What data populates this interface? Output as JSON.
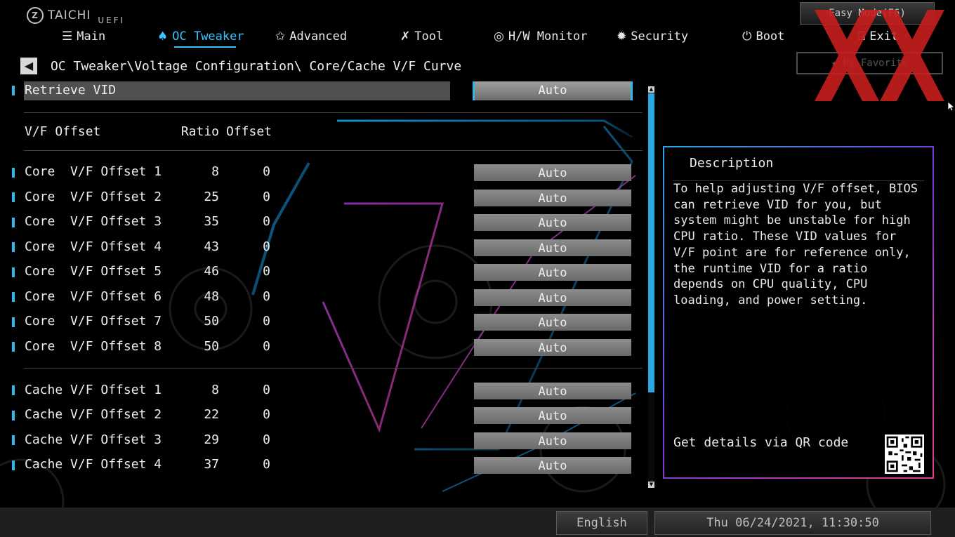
{
  "brand": {
    "name": "TAICHI",
    "suffix": "UEFI",
    "badge": "Z"
  },
  "colors": {
    "accent": "#37c5ff",
    "marker": "#2fb8f0",
    "watermark": "#c81e1e",
    "background": "#000000"
  },
  "nav": [
    {
      "label": "Main",
      "icon": "list-icon"
    },
    {
      "label": "OC Tweaker",
      "icon": "rocket-icon",
      "active": true
    },
    {
      "label": "Advanced",
      "icon": "star-icon"
    },
    {
      "label": "Tool",
      "icon": "tools-icon"
    },
    {
      "label": "H/W Monitor",
      "icon": "monitor-gauge-icon"
    },
    {
      "label": "Security",
      "icon": "shield-gear-icon"
    },
    {
      "label": "Boot",
      "icon": "power-icon"
    },
    {
      "label": "Exit",
      "icon": "exit-door-icon"
    }
  ],
  "top_buttons": {
    "easy_mode": "Easy Mode(F6)",
    "favorite": "My Favorite"
  },
  "breadcrumb": "OC Tweaker\\Voltage Configuration\\ Core/Cache V/F Curve",
  "retrieve": {
    "label": "Retrieve VID",
    "value": "Auto"
  },
  "table_header": {
    "col1": "V/F Offset",
    "col2": "Ratio",
    "col3": "Offset"
  },
  "core_rows": [
    {
      "label": "Core  V/F Offset 1",
      "ratio": "8",
      "offset": "0",
      "value": "Auto"
    },
    {
      "label": "Core  V/F Offset 2",
      "ratio": "25",
      "offset": "0",
      "value": "Auto"
    },
    {
      "label": "Core  V/F Offset 3",
      "ratio": "35",
      "offset": "0",
      "value": "Auto"
    },
    {
      "label": "Core  V/F Offset 4",
      "ratio": "43",
      "offset": "0",
      "value": "Auto"
    },
    {
      "label": "Core  V/F Offset 5",
      "ratio": "46",
      "offset": "0",
      "value": "Auto"
    },
    {
      "label": "Core  V/F Offset 6",
      "ratio": "48",
      "offset": "0",
      "value": "Auto"
    },
    {
      "label": "Core  V/F Offset 7",
      "ratio": "50",
      "offset": "0",
      "value": "Auto"
    },
    {
      "label": "Core  V/F Offset 8",
      "ratio": "50",
      "offset": "0",
      "value": "Auto"
    }
  ],
  "cache_rows": [
    {
      "label": "Cache V/F Offset 1",
      "ratio": "8",
      "offset": "0",
      "value": "Auto"
    },
    {
      "label": "Cache V/F Offset 2",
      "ratio": "22",
      "offset": "0",
      "value": "Auto"
    },
    {
      "label": "Cache V/F Offset 3",
      "ratio": "29",
      "offset": "0",
      "value": "Auto"
    },
    {
      "label": "Cache V/F Offset 4",
      "ratio": "37",
      "offset": "0",
      "value": "Auto"
    }
  ],
  "description": {
    "title": "Description",
    "text": "To help adjusting V/F offset, BIOS can retrieve VID for you, but system might be unstable for high CPU ratio. These VID values for V/F point are for reference only, the runtime VID for a ratio depends on CPU quality, CPU loading, and power setting.",
    "qr_label": "Get details via QR code"
  },
  "footer": {
    "language": "English",
    "datetime": "Thu 06/24/2021, 11:30:50"
  }
}
